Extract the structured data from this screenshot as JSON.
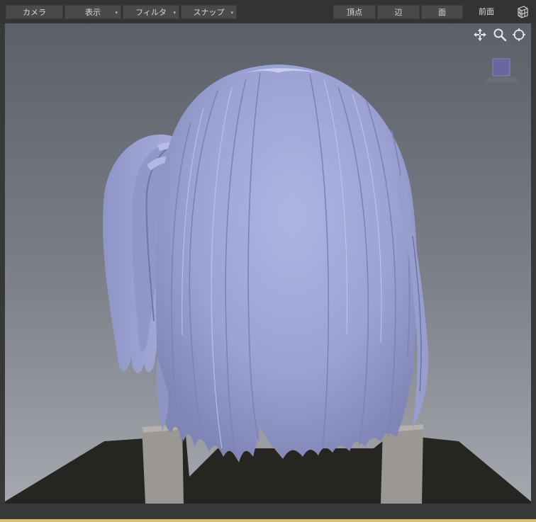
{
  "toolbar": {
    "camera_label": "カメラ",
    "display_label": "表示",
    "filter_label": "フィルタ",
    "snap_label": "スナップ",
    "vertex_label": "頂点",
    "edge_label": "辺",
    "face_label": "面",
    "view_label": "前面",
    "dropdown_glyph": "▾"
  },
  "icons": {
    "pan": "move-icon",
    "zoom": "zoom-icon",
    "orbit": "orbit-icon",
    "view_cube": "view-cube-icon"
  },
  "colors": {
    "toolbar_bg": "#333333",
    "button_bg": "#4a4a4a",
    "hair": "#a6acdb",
    "hair_shadow": "#7c82b0",
    "clothing": "#262522",
    "strap": "#9a9794",
    "gizmo": "#6c669e",
    "accent": "#d8c07a"
  }
}
